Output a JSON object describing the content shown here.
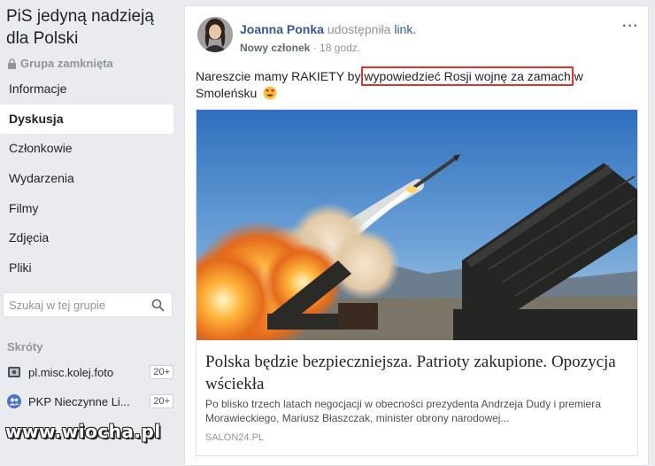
{
  "group": {
    "name": "PiS jedyną nadzieją dla Polski",
    "privacy": "Grupa zamknięta"
  },
  "nav": {
    "items": [
      {
        "label": "Informacje"
      },
      {
        "label": "Dyskusja"
      },
      {
        "label": "Członkowie"
      },
      {
        "label": "Wydarzenia"
      },
      {
        "label": "Filmy"
      },
      {
        "label": "Zdjęcia"
      },
      {
        "label": "Pliki"
      }
    ],
    "active": "Dyskusja"
  },
  "search": {
    "placeholder": "Szukaj w tej grupie"
  },
  "shortcuts": {
    "title": "Skróty",
    "items": [
      {
        "label": "pl.misc.kolej.foto",
        "count": "20+",
        "icon": "photo-group-icon"
      },
      {
        "label": "PKP Nieczynne Li...",
        "count": "20+",
        "icon": "group-icon"
      }
    ]
  },
  "watermark": "www.wiocha.pl",
  "post": {
    "author": "Joanna Ponka",
    "action": "udostępniła",
    "action_link": "link.",
    "badge": "Nowy członek",
    "time": "18 godz.",
    "more": "···",
    "text_before": "Nareszcie mamy RAKIETY by ",
    "text_highlight": "wypowiedzieć Rosji wojnę za zamach",
    "text_after": " w Smoleńsku",
    "emoji": "heart-eyes-emoji-icon",
    "preview": {
      "title": "Polska będzie bezpieczniejsza. Patrioty zakupione. Opozycja wściekła",
      "description": "Po blisko trzech latach negocjacji w obecności prezydenta Andrzeja Dudy i premiera Morawieckiego, Mariusz Błaszczak, minister obrony narodowej...",
      "domain": "SALON24.PL"
    }
  },
  "colors": {
    "link": "#365899",
    "background": "#e9ebee",
    "highlight_box": "#dd3333"
  }
}
